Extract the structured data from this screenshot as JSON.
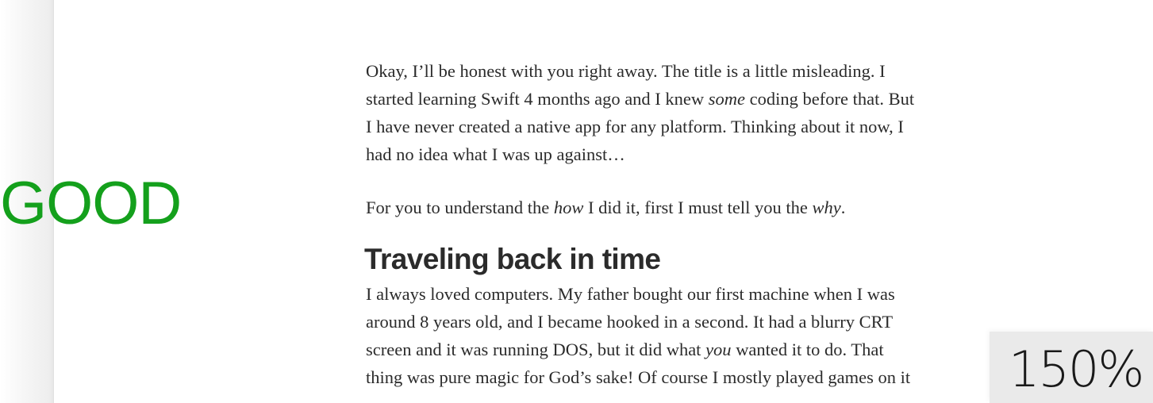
{
  "status_label": {
    "text": "GOOD",
    "color": "#14a01c"
  },
  "article": {
    "paragraph1": [
      {
        "t": "Okay, I’ll be honest with you right away. The title is a little misleading. I"
      },
      {
        "t": "started learning Swift 4 months ago and I knew "
      },
      {
        "t": "some",
        "em": true
      },
      {
        "t": " coding before that. But"
      },
      {
        "t": "I have never created a native app for any platform. Thinking about it now, I"
      },
      {
        "t": "had no idea what I was up against…"
      }
    ],
    "paragraph2": {
      "part1": "For you to understand the ",
      "em1": "how",
      "part2": " I did it, first I must tell you the ",
      "em2": "why",
      "part3": "."
    },
    "heading": "Traveling back in time",
    "paragraph3": {
      "line1": "I always loved computers. My father bought our first machine when I was",
      "line2": "around 8 years old, and I became hooked in a second. It had a blurry CRT",
      "line3_part1": "screen and it was running DOS, but it did what ",
      "line3_em": "you",
      "line3_part2": " wanted it to do. That",
      "line4": "thing was pure magic for God’s sake! Of course I mostly played games on it"
    }
  },
  "zoom": {
    "text": "150%"
  }
}
